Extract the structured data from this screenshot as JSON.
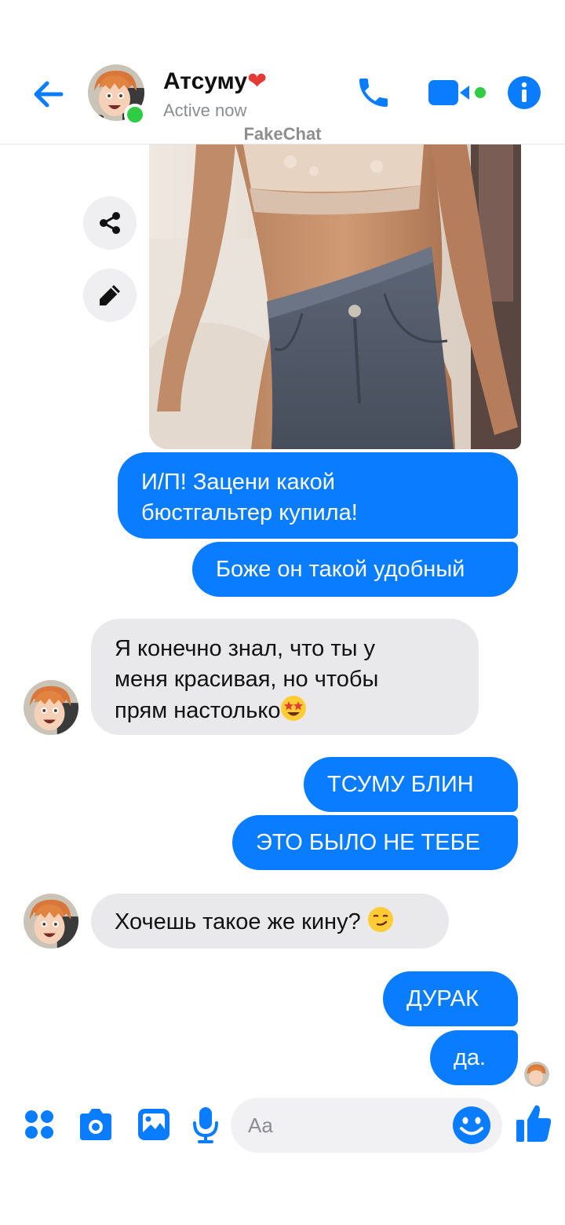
{
  "header": {
    "name": "Атсуму",
    "name_emoji": "❤",
    "status": "Active now",
    "watermark": "FakeChat"
  },
  "messages": {
    "m1": "И/П! Зацени какой",
    "m1b": "бюстгальтер купила!",
    "m2": "Боже он такой удобный",
    "m3a": "Я конечно знал, что ты у",
    "m3b": "меня красивая, но чтобы",
    "m3c": "прям настолько",
    "m4": "ТСУМУ БЛИН",
    "m5": "ЭТО БЫЛО НЕ ТЕБЕ",
    "m6": "Хочешь такое же кину? ",
    "m7": "ДУРАК",
    "m8": "да."
  },
  "composer": {
    "placeholder": "Aa"
  },
  "colors": {
    "accent": "#0a7cff",
    "online": "#31cc46",
    "incoming_bubble": "#e9e9eb"
  },
  "icons": [
    "back-arrow-icon",
    "phone-icon",
    "video-icon",
    "info-icon",
    "share-icon",
    "pencil-icon",
    "apps-icon",
    "camera-icon",
    "gallery-icon",
    "mic-icon",
    "emoji-icon",
    "thumbs-up-icon"
  ]
}
